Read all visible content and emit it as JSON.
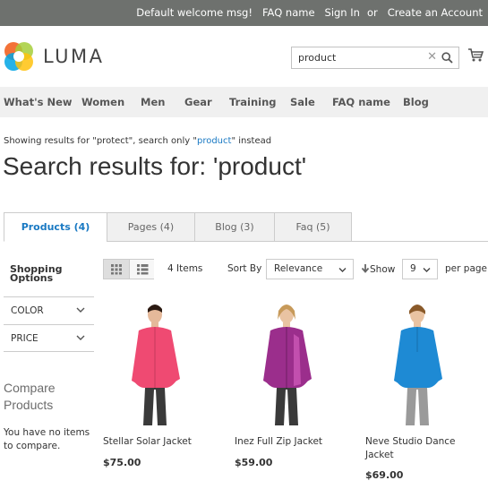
{
  "topbar": {
    "welcome": "Default welcome msg!",
    "faq": "FAQ name",
    "signin": "Sign In",
    "or": "or",
    "create_account": "Create an Account"
  },
  "header": {
    "logo_text": "LUMA",
    "search_value": "product"
  },
  "nav": {
    "items": [
      "What's New",
      "Women",
      "Men",
      "Gear",
      "Training",
      "Sale",
      "FAQ name",
      "Blog"
    ]
  },
  "search_note": {
    "prefix": "Showing results for \"protect\", search only \"",
    "link": "product",
    "suffix": "\" instead"
  },
  "page_title": "Search results for: 'product'",
  "tabs": [
    {
      "label": "Products (4)",
      "active": true
    },
    {
      "label": "Pages (4)",
      "active": false
    },
    {
      "label": "Blog (3)",
      "active": false
    },
    {
      "label": "Faq (5)",
      "active": false
    }
  ],
  "sidebar": {
    "title_line1": "Shopping",
    "title_line2": "Options",
    "filters": [
      "COLOR",
      "PRICE"
    ],
    "compare_title": "Compare Products",
    "compare_note": "You have no items to compare."
  },
  "toolbar": {
    "count": "4 Items",
    "sort_label": "Sort By",
    "sort_value": "Relevance",
    "show_label": "Show",
    "limit_value": "9",
    "per_page": "per page"
  },
  "products": [
    {
      "name": "Stellar Solar Jacket",
      "price": "$75.00",
      "color": "#ef4a72"
    },
    {
      "name": "Inez Full Zip Jacket",
      "price": "$59.00",
      "color": "#9b2e8c"
    },
    {
      "name": "Neve Studio Dance Jacket",
      "price": "$69.00",
      "color": "#1e8ad4"
    }
  ],
  "colors": {
    "link": "#1979c3",
    "topbar": "#6e716e",
    "nav_bg": "#f0f0f0"
  }
}
